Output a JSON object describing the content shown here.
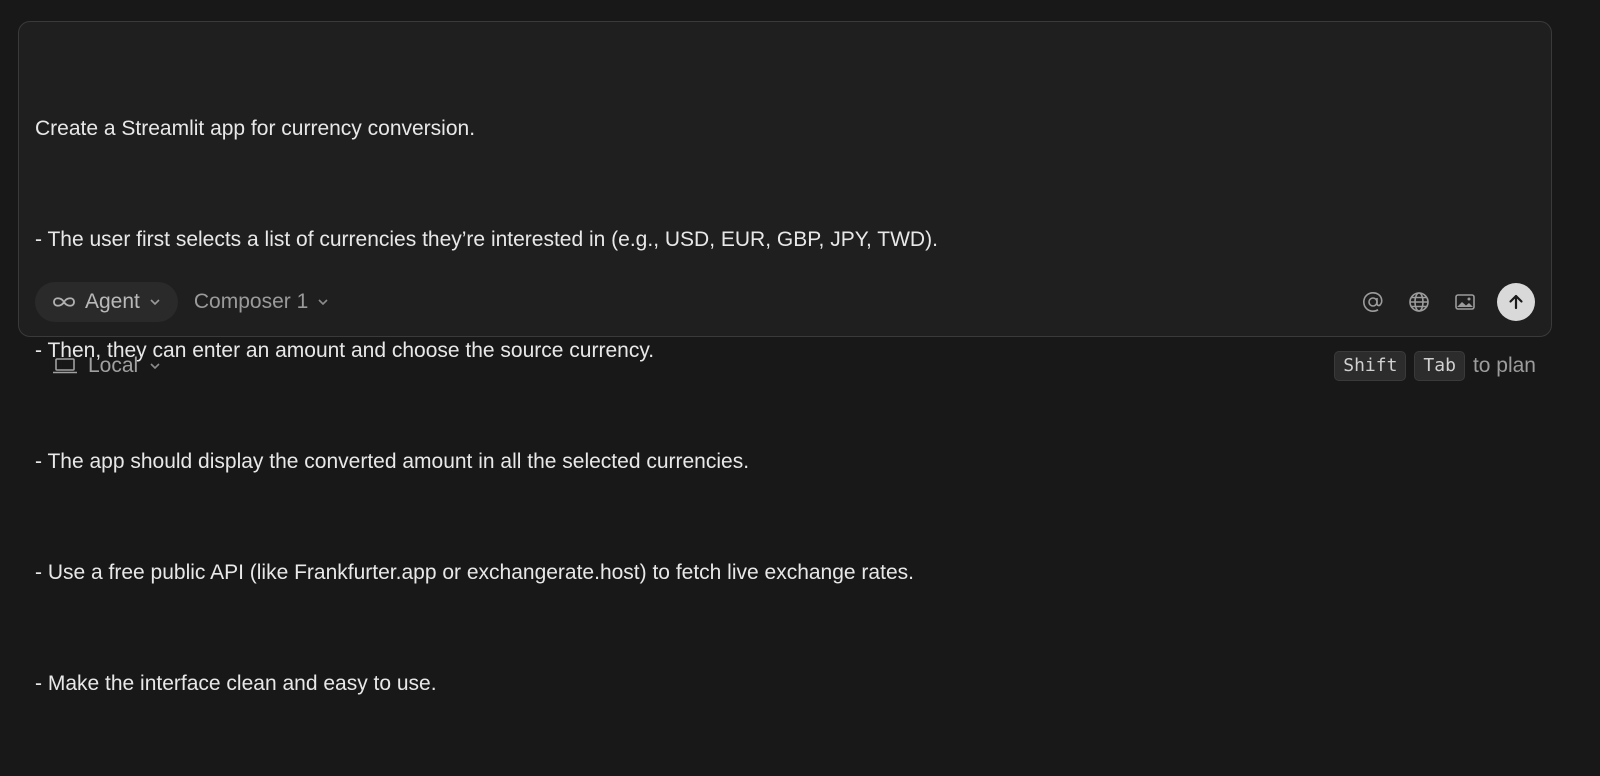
{
  "prompt": {
    "lines": [
      "Create a Streamlit app for currency conversion.",
      "- The user first selects a list of currencies they’re interested in (e.g., USD, EUR, GBP, JPY, TWD).",
      "- Then, they can enter an amount and choose the source currency.",
      "- The app should display the converted amount in all the selected currencies.",
      "- Use a free public API (like Frankfurter.app or exchangerate.host) to fetch live exchange rates.",
      "- Make the interface clean and easy to use."
    ]
  },
  "toolbar": {
    "mode_label": "Agent",
    "mode_icon": "infinity-icon",
    "model_label": "Composer 1",
    "tools": [
      "at-icon",
      "globe-icon",
      "image-icon"
    ],
    "send_icon": "arrow-up-icon"
  },
  "footer": {
    "environment_label": "Local",
    "environment_icon": "laptop-icon",
    "hint_keys": [
      "Shift",
      "Tab"
    ],
    "hint_text": "to plan"
  }
}
